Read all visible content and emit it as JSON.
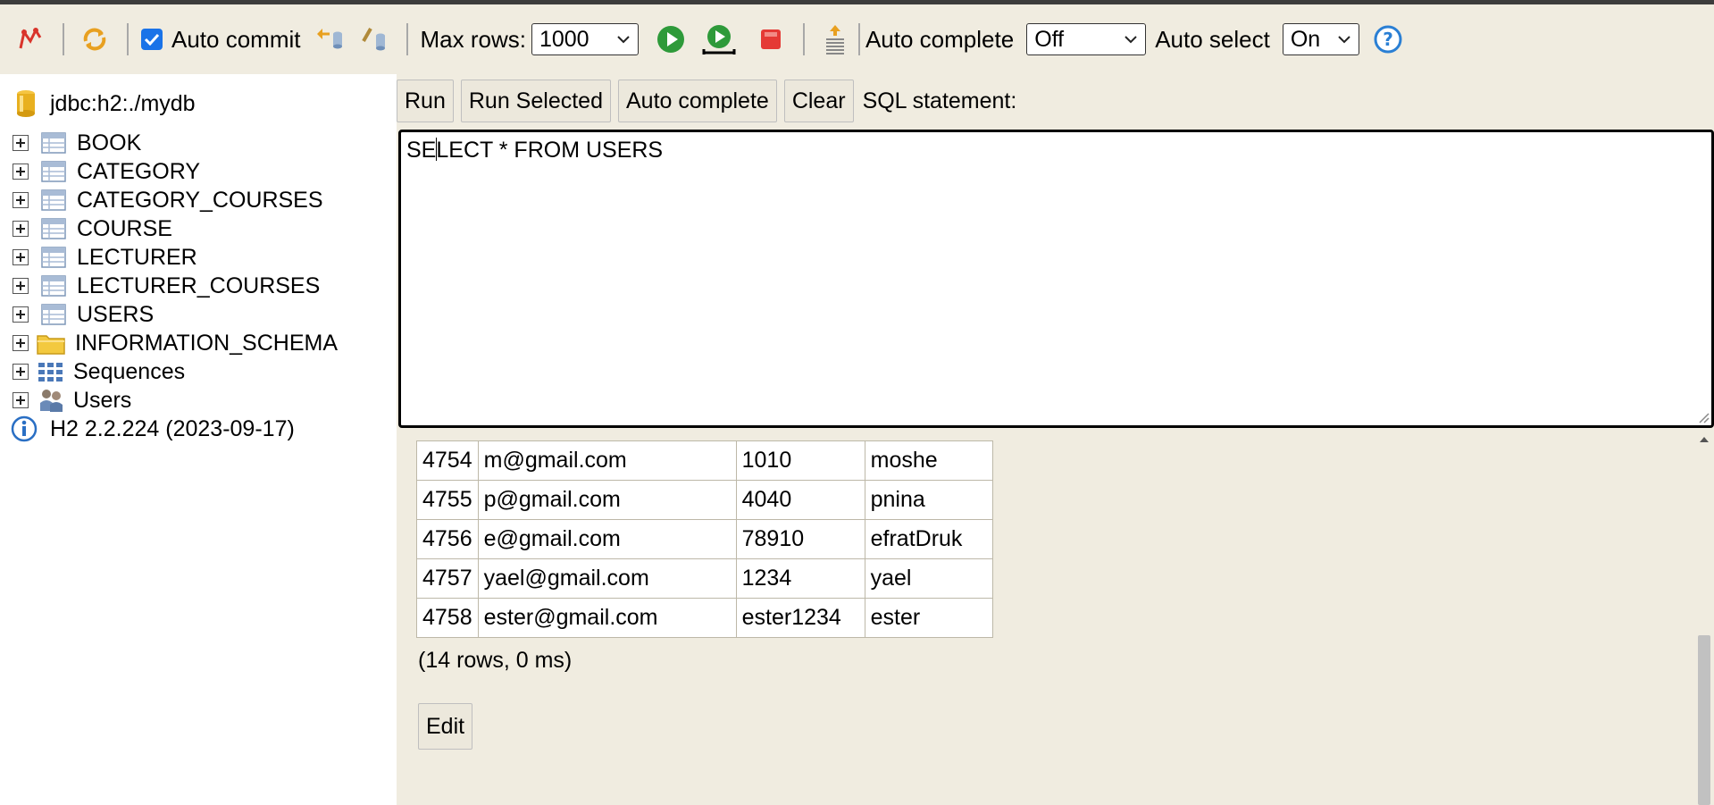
{
  "toolbar": {
    "auto_commit_label": "Auto commit",
    "auto_commit_checked": true,
    "max_rows_label": "Max rows:",
    "max_rows_value": "1000",
    "auto_complete_label": "Auto complete",
    "auto_complete_value": "Off",
    "auto_select_label": "Auto select",
    "auto_select_value": "On",
    "icons": [
      "disconnect-icon",
      "refresh-icon",
      "rollback-icon",
      "commit-icon",
      "run-icon",
      "run-selected-icon",
      "stop-icon",
      "history-icon",
      "help-icon"
    ],
    "colors": {
      "run_green": "#2e9a3a",
      "stop_red": "#e53935",
      "help_blue": "#2a7fd4",
      "panel_bg": "#f0ece0"
    }
  },
  "tree": {
    "connection": "jdbc:h2:./mydb",
    "tables": [
      "BOOK",
      "CATEGORY",
      "CATEGORY_COURSES",
      "COURSE",
      "LECTURER",
      "LECTURER_COURSES",
      "USERS"
    ],
    "schema": "INFORMATION_SCHEMA",
    "sequences": "Sequences",
    "users": "Users",
    "version": "H2 2.2.224 (2023-09-17)"
  },
  "buttons": {
    "run": "Run",
    "run_selected": "Run Selected",
    "auto_complete": "Auto complete",
    "clear": "Clear",
    "sql_label": "SQL statement:"
  },
  "sql": {
    "before_caret": "SE",
    "after_caret": "LECT * FROM USERS"
  },
  "results": {
    "rows": [
      [
        "4754",
        "m@gmail.com",
        "1010",
        "moshe"
      ],
      [
        "4755",
        "p@gmail.com",
        "4040",
        "pnina"
      ],
      [
        "4756",
        "e@gmail.com",
        "78910",
        "efratDruk"
      ],
      [
        "4757",
        "yael@gmail.com",
        "1234",
        "yael"
      ],
      [
        "4758",
        "ester@gmail.com",
        "ester1234",
        "ester"
      ]
    ],
    "row_count": "(14 rows, 0 ms)",
    "edit_label": "Edit"
  }
}
